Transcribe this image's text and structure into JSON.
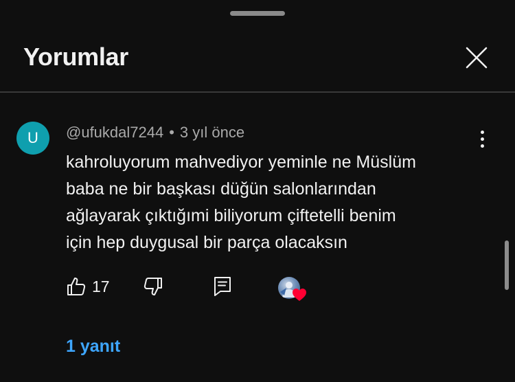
{
  "header": {
    "title": "Yorumlar"
  },
  "comment": {
    "avatar_letter": "U",
    "avatar_color": "#0f9fae",
    "author": "@ufukdal7244",
    "separator": "•",
    "time": "3 yıl önce",
    "text_lines": [
      "kahroluyorum mahvediyor yeminle ne Müslüm",
      "baba ne bir başkası düğün salonlarından",
      "ağlayarak çıktığımi biliyorum çiftetelli benim",
      "için hep duygusal bir parça olacaksın"
    ],
    "like_count": "17",
    "replies_label": "1 yanıt"
  },
  "icons": {
    "close": "close-icon",
    "more": "more-vertical-icon",
    "like": "thumbs-up-icon",
    "dislike": "thumbs-down-icon",
    "reply": "comment-icon",
    "heart": "heart-icon"
  },
  "colors": {
    "background": "#0f0f0f",
    "text": "#f1f1f1",
    "secondary_text": "#aaaaaa",
    "link": "#3ea6ff",
    "heart": "#ff0033"
  }
}
